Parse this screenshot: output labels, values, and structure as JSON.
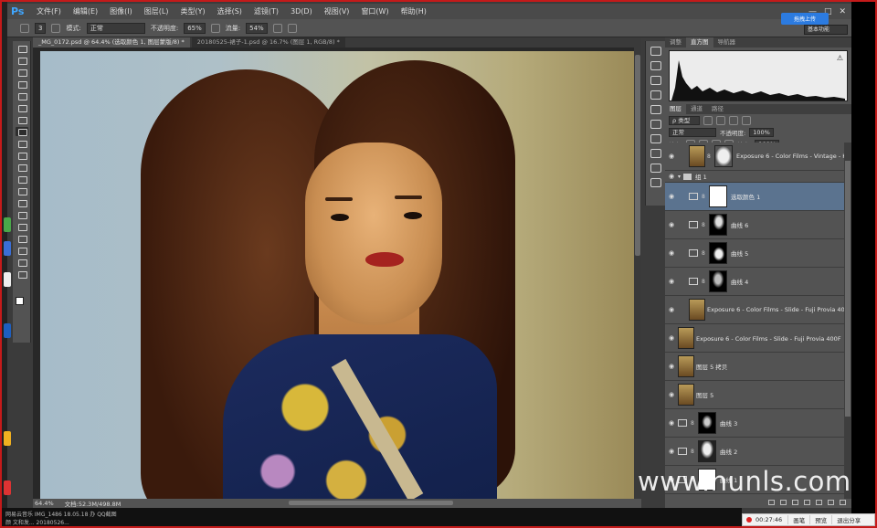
{
  "app": {
    "logo": "Ps"
  },
  "menu": [
    "文件(F)",
    "编辑(E)",
    "图像(I)",
    "图层(L)",
    "类型(Y)",
    "选择(S)",
    "滤镜(T)",
    "3D(D)",
    "视图(V)",
    "窗口(W)",
    "帮助(H)"
  ],
  "window_controls": [
    "—",
    "□",
    "✕"
  ],
  "upload_button": "拖拽上传",
  "workspace": "基本功能",
  "options": {
    "brush_size": "3",
    "mode_label": "模式:",
    "mode_value": "正常",
    "opacity_label": "不透明度:",
    "opacity_value": "65%",
    "flow_label": "流量:",
    "flow_value": "54%"
  },
  "doc_tabs": [
    {
      "title": "_MG_0172.psd @ 64.4% (选取颜色 1, 图层蒙版/8) *",
      "active": true
    },
    {
      "title": "20180525-裙子-1.psd @ 16.7% (图层 1, RGB/8) *",
      "active": false
    }
  ],
  "status": {
    "zoom": "64.4%",
    "doc_info": "文档:52.3M/498.8M"
  },
  "bottom_strip": {
    "line1": "网易云音乐    IMG_1486    18.05.18 办    QQ截图",
    "line2": "颜 文和发...   20180526..."
  },
  "recorder": {
    "time": "00:27:46",
    "buttons": [
      "画笔",
      "预览",
      "退出分享"
    ]
  },
  "panels": {
    "top_tabs": [
      "调整",
      "直方图",
      "导航器"
    ],
    "top_active": 1,
    "layer_tabs": [
      "图层",
      "通道",
      "路径"
    ],
    "layer_active": 0,
    "kind_filter": "ρ 类型",
    "blend_mode": "正常",
    "opacity_label": "不透明度:",
    "opacity_value": "100%",
    "lock_label": "锁定:",
    "fill_label": "填充:",
    "fill_value": "100%"
  },
  "layers": [
    {
      "name": "Exposure 6 - Color Films - Vintage - Kod...",
      "type": "pixel-mask",
      "indent": 0,
      "mask": "gray",
      "selected": false
    },
    {
      "name": "组 1",
      "type": "group",
      "indent": 0,
      "selected": false
    },
    {
      "name": "选取颜色 1",
      "type": "adjustment",
      "indent": 1,
      "mask": "white",
      "selected": true
    },
    {
      "name": "曲线 6",
      "type": "adjustment",
      "indent": 1,
      "mask": "dark",
      "selected": false
    },
    {
      "name": "曲线 5",
      "type": "adjustment",
      "indent": 1,
      "mask": "dark",
      "selected": false
    },
    {
      "name": "曲线 4",
      "type": "adjustment",
      "indent": 1,
      "mask": "dark",
      "selected": false
    },
    {
      "name": "Exposure 6 - Color Films - Slide - Fuji Provia 400F",
      "type": "pixel",
      "indent": 1,
      "selected": false
    },
    {
      "name": "Exposure 6 - Color Films - Slide - Fuji Provia 400F（已...",
      "type": "pixel",
      "indent": 0,
      "selected": false
    },
    {
      "name": "图层 5 拷贝",
      "type": "pixel",
      "indent": 0,
      "selected": false
    },
    {
      "name": "图层 5",
      "type": "pixel",
      "indent": 0,
      "selected": false
    },
    {
      "name": "曲线 3",
      "type": "adjustment",
      "indent": 0,
      "mask": "dark",
      "selected": false
    },
    {
      "name": "曲线 2",
      "type": "adjustment",
      "indent": 0,
      "mask": "dark",
      "selected": false
    },
    {
      "name": "曲线 1",
      "type": "adjustment",
      "indent": 0,
      "mask": "white",
      "selected": false
    }
  ],
  "watermark": "www.hunls.com",
  "colors": {
    "accent": "#2c7be0",
    "selected_layer": "#5b738f",
    "border": "#c41a1a"
  }
}
